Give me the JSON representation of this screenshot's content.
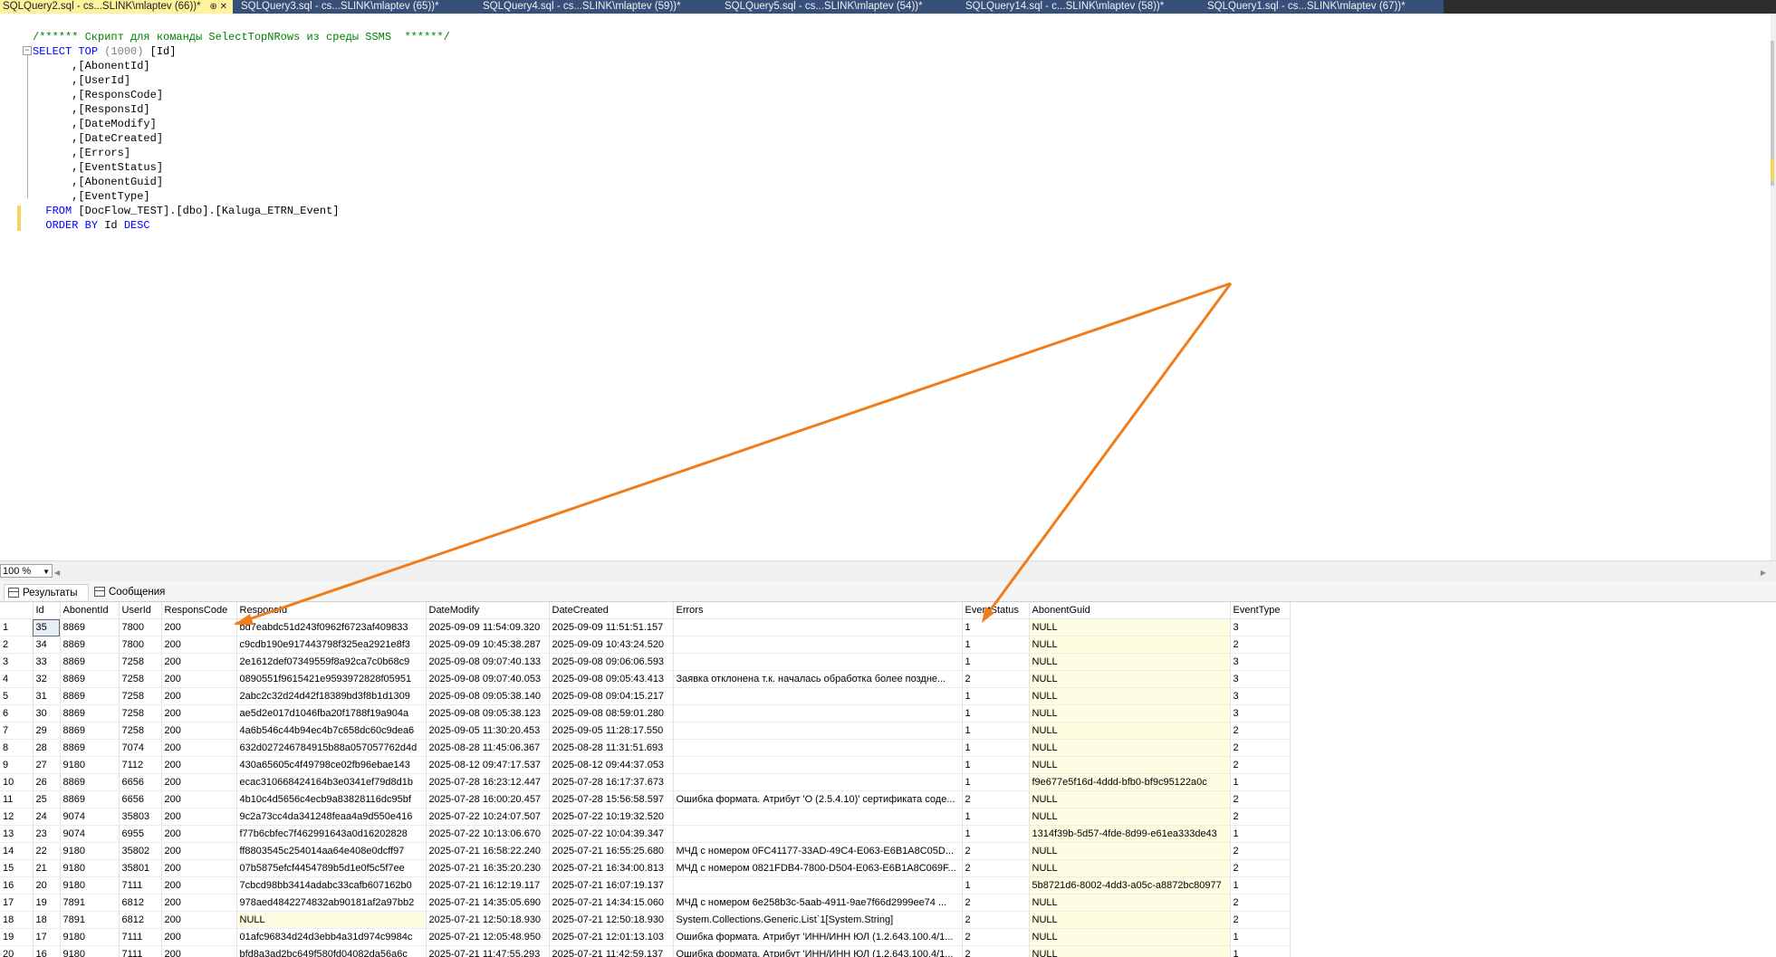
{
  "tabs": [
    {
      "label": "SQLQuery2.sql - cs...SLINK\\mlaptev (66))*",
      "pin": "⊕ ✕",
      "active": true
    },
    {
      "label": "SQLQuery3.sql - cs...SLINK\\mlaptev (65))*"
    },
    {
      "label": "SQLQuery4.sql - cs...SLINK\\mlaptev (59))*"
    },
    {
      "label": "SQLQuery5.sql - cs...SLINK\\mlaptev (54))*"
    },
    {
      "label": "SQLQuery14.sql - c...SLINK\\mlaptev (58))*"
    },
    {
      "label": "SQLQuery1.sql - cs...SLINK\\mlaptev (67))*"
    }
  ],
  "editor": {
    "comment": "/****** Скрипт для команды SelectTopNRows из среды SSMS  ******/",
    "select": "SELECT",
    "top": "TOP",
    "top_arg": "(1000)",
    "first_col": "[Id]",
    "columns": [
      ",[AbonentId]",
      ",[UserId]",
      ",[ResponsCode]",
      ",[ResponsId]",
      ",[DateModify]",
      ",[DateCreated]",
      ",[Errors]",
      ",[EventStatus]",
      ",[AbonentGuid]",
      ",[EventType]"
    ],
    "from": "FROM",
    "table": "[DocFlow_TEST].[dbo].[Kaluga_ETRN_Event]",
    "order": "ORDER BY",
    "order_col": "Id",
    "desc": "DESC"
  },
  "zoom": "100 %",
  "result_tabs": {
    "results": "Результаты",
    "messages": "Сообщения"
  },
  "grid": {
    "columns": [
      "",
      "Id",
      "AbonentId",
      "UserId",
      "ResponsCode",
      "ResponsId",
      "DateModify",
      "DateCreated",
      "Errors",
      "EventStatus",
      "AbonentGuid",
      "EventType"
    ],
    "rows": [
      [
        "1",
        "35",
        "8869",
        "7800",
        "200",
        "bd7eabdc51d243f0962f6723af409833",
        "2025-09-09 11:54:09.320",
        "2025-09-09 11:51:51.157",
        "",
        "1",
        "NULL",
        "3"
      ],
      [
        "2",
        "34",
        "8869",
        "7800",
        "200",
        "c9cdb190e917443798f325ea2921e8f3",
        "2025-09-09 10:45:38.287",
        "2025-09-09 10:43:24.520",
        "",
        "1",
        "NULL",
        "2"
      ],
      [
        "3",
        "33",
        "8869",
        "7258",
        "200",
        "2e1612def07349559f8a92ca7c0b68c9",
        "2025-09-08 09:07:40.133",
        "2025-09-08 09:06:06.593",
        "",
        "1",
        "NULL",
        "3"
      ],
      [
        "4",
        "32",
        "8869",
        "7258",
        "200",
        "0890551f9615421e9593972828f05951",
        "2025-09-08 09:07:40.053",
        "2025-09-08 09:05:43.413",
        "Заявка отклонена т.к. началась обработка более поздне...",
        "2",
        "NULL",
        "3"
      ],
      [
        "5",
        "31",
        "8869",
        "7258",
        "200",
        "2abc2c32d24d42f18389bd3f8b1d1309",
        "2025-09-08 09:05:38.140",
        "2025-09-08 09:04:15.217",
        "",
        "1",
        "NULL",
        "3"
      ],
      [
        "6",
        "30",
        "8869",
        "7258",
        "200",
        "ae5d2e017d1046fba20f1788f19a904a",
        "2025-09-08 09:05:38.123",
        "2025-09-08 08:59:01.280",
        "",
        "1",
        "NULL",
        "3"
      ],
      [
        "7",
        "29",
        "8869",
        "7258",
        "200",
        "4a6b546c44b94ec4b7c658dc60c9dea6",
        "2025-09-05 11:30:20.453",
        "2025-09-05 11:28:17.550",
        "",
        "1",
        "NULL",
        "2"
      ],
      [
        "8",
        "28",
        "8869",
        "7074",
        "200",
        "632d027246784915b88a057057762d4d",
        "2025-08-28 11:45:06.367",
        "2025-08-28 11:31:51.693",
        "",
        "1",
        "NULL",
        "2"
      ],
      [
        "9",
        "27",
        "9180",
        "7112",
        "200",
        "430a65605c4f49798ce02fb96ebae143",
        "2025-08-12 09:47:17.537",
        "2025-08-12 09:44:37.053",
        "",
        "1",
        "NULL",
        "2"
      ],
      [
        "10",
        "26",
        "8869",
        "6656",
        "200",
        "ecac310668424164b3e0341ef79d8d1b",
        "2025-07-28 16:23:12.447",
        "2025-07-28 16:17:37.673",
        "",
        "1",
        "f9e677e5f16d-4ddd-bfb0-bf9c95122a0c",
        "1"
      ],
      [
        "11",
        "25",
        "8869",
        "6656",
        "200",
        "4b10c4d5656c4ecb9a83828116dc95bf",
        "2025-07-28 16:00:20.457",
        "2025-07-28 15:56:58.597",
        "Ошибка формата. Атрибут 'О (2.5.4.10)' сертификата соде...",
        "2",
        "NULL",
        "2"
      ],
      [
        "12",
        "24",
        "9074",
        "35803",
        "200",
        "9c2a73cc4da341248feaa4a9d550e416",
        "2025-07-22 10:24:07.507",
        "2025-07-22 10:19:32.520",
        "",
        "1",
        "NULL",
        "2"
      ],
      [
        "13",
        "23",
        "9074",
        "6955",
        "200",
        "f77b6cbfec7f462991643a0d16202828",
        "2025-07-22 10:13:06.670",
        "2025-07-22 10:04:39.347",
        "",
        "1",
        "1314f39b-5d57-4fde-8d99-e61ea333de43",
        "1"
      ],
      [
        "14",
        "22",
        "9180",
        "35802",
        "200",
        "ff8803545c254014aa64e408e0dcff97",
        "2025-07-21 16:58:22.240",
        "2025-07-21 16:55:25.680",
        "МЧД с номером 0FC41177-33AD-49C4-E063-E6B1A8C05D...",
        "2",
        "NULL",
        "2"
      ],
      [
        "15",
        "21",
        "9180",
        "35801",
        "200",
        "07b5875efcf4454789b5d1e0f5c5f7ee",
        "2025-07-21 16:35:20.230",
        "2025-07-21 16:34:00.813",
        "МЧД с номером 0821FDB4-7800-D504-E063-E6B1A8C069F...",
        "2",
        "NULL",
        "2"
      ],
      [
        "16",
        "20",
        "9180",
        "7111",
        "200",
        "7cbcd98bb3414adabc33cafb607162b0",
        "2025-07-21 16:12:19.117",
        "2025-07-21 16:07:19.137",
        "",
        "1",
        "5b8721d6-8002-4dd3-a05c-a8872bc80977",
        "1"
      ],
      [
        "17",
        "19",
        "7891",
        "6812",
        "200",
        "978aed4842274832ab90181af2a97bb2",
        "2025-07-21 14:35:05.690",
        "2025-07-21 14:34:15.060",
        "МЧД с номером 6e258b3c-5aab-4911-9ae7f66d2999ee74 ...",
        "2",
        "NULL",
        "2"
      ],
      [
        "18",
        "18",
        "7891",
        "6812",
        "200",
        "NULL",
        "2025-07-21 12:50:18.930",
        "2025-07-21 12:50:18.930",
        "System.Collections.Generic.List`1[System.String]",
        "2",
        "NULL",
        "2"
      ],
      [
        "19",
        "17",
        "9180",
        "7111",
        "200",
        "01afc96834d24d3ebb4a31d974c9984c",
        "2025-07-21 12:05:48.950",
        "2025-07-21 12:01:13.103",
        "Ошибка формата. Атрибут 'ИНН/ИНН ЮЛ (1.2.643.100.4/1...",
        "2",
        "NULL",
        "1"
      ],
      [
        "20",
        "16",
        "9180",
        "7111",
        "200",
        "bfd8a3ad2bc649f580fd04082da56a6c",
        "2025-07-21 11:47:55.293",
        "2025-07-21 11:42:59.137",
        "Ошибка формата. Атрибут 'ИНН/ИНН ЮЛ (1.2.643.100.4/1...",
        "2",
        "NULL",
        "1"
      ]
    ]
  },
  "colors": {
    "arrow": "#f07d1a",
    "active_tab": "#fff29d",
    "null_cell": "#fffde1"
  }
}
